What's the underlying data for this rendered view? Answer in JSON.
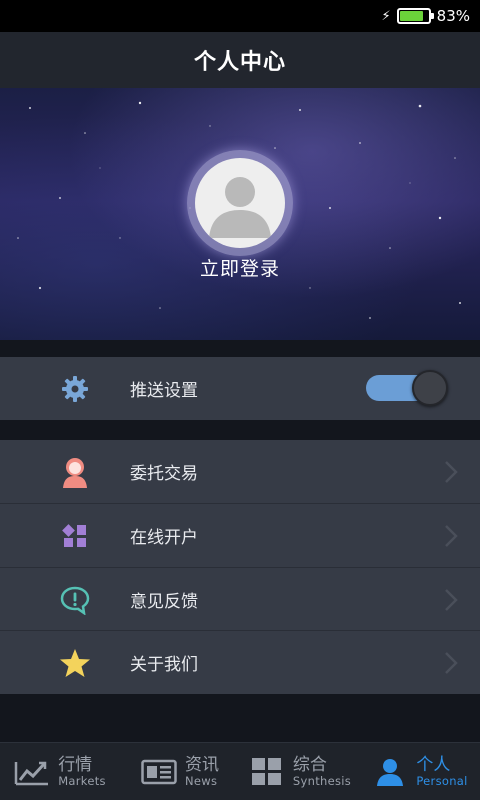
{
  "status_bar": {
    "battery_percent": "83%",
    "battery_level": 0.83,
    "charging": true,
    "battery_color": "#6bd33a"
  },
  "title_bar": {
    "title": "个人中心"
  },
  "profile": {
    "login_label": "立即登录",
    "avatar": "default-person-avatar"
  },
  "settings_group": {
    "push": {
      "icon": "gear-icon",
      "label": "推送设置",
      "toggle_on": true
    }
  },
  "menu": {
    "items": [
      {
        "icon": "person-icon",
        "label": "委托交易",
        "icon_color": "#f08c82"
      },
      {
        "icon": "grid-icon",
        "label": "在线开户",
        "icon_color": "#a27fd6"
      },
      {
        "icon": "speech-bubble-alert-icon",
        "label": "意见反馈",
        "icon_color": "#56c1b4"
      },
      {
        "icon": "star-icon",
        "label": "关于我们",
        "icon_color": "#f3d35c"
      }
    ]
  },
  "bottom_nav": {
    "tabs": [
      {
        "icon": "chart-trend-icon",
        "cn": "行情",
        "en": "Markets",
        "active": false
      },
      {
        "icon": "newspaper-icon",
        "cn": "资讯",
        "en": "News",
        "active": false
      },
      {
        "icon": "grid-tiles-icon",
        "cn": "综合",
        "en": "Synthesis",
        "active": false
      },
      {
        "icon": "person-icon",
        "cn": "个人",
        "en": "Personal",
        "active": true
      }
    ],
    "active_color": "#2e8fe6"
  }
}
